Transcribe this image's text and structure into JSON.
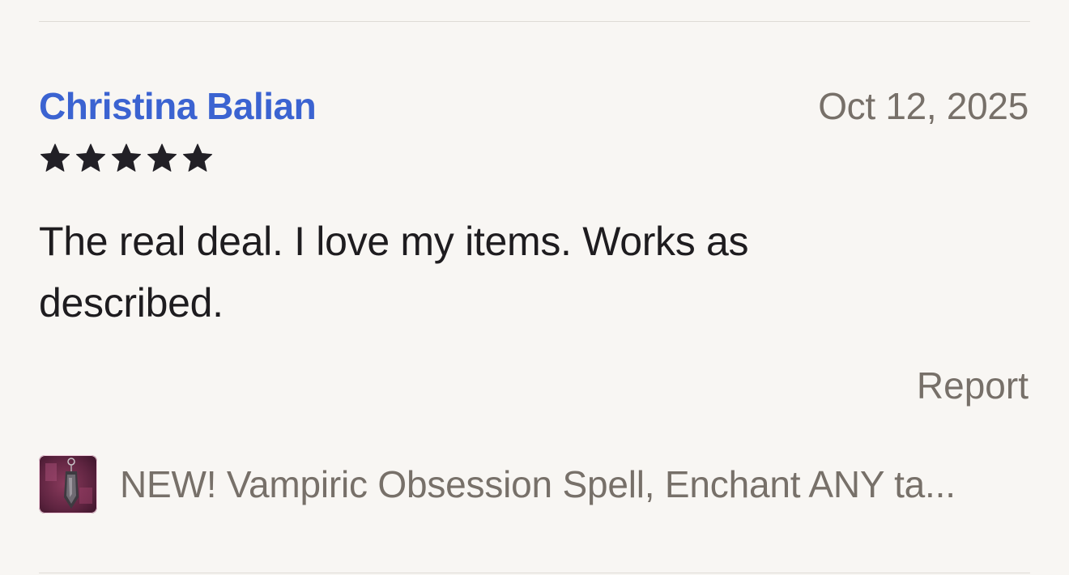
{
  "review": {
    "reviewer_name": "Christina Balian",
    "date": "Oct 12, 2025",
    "rating": 5,
    "max_rating": 5,
    "text": "The real deal. I love my items. Works as described.",
    "report_label": "Report",
    "item_title": "NEW! Vampiric Obsession Spell, Enchant ANY ta...",
    "thumbnail_icon": "product-thumbnail"
  },
  "colors": {
    "reviewer_link": "#3b63d1",
    "muted_text": "#777069",
    "body_text": "#1e1c1f",
    "star": "#222026",
    "background": "#f8f6f3"
  }
}
